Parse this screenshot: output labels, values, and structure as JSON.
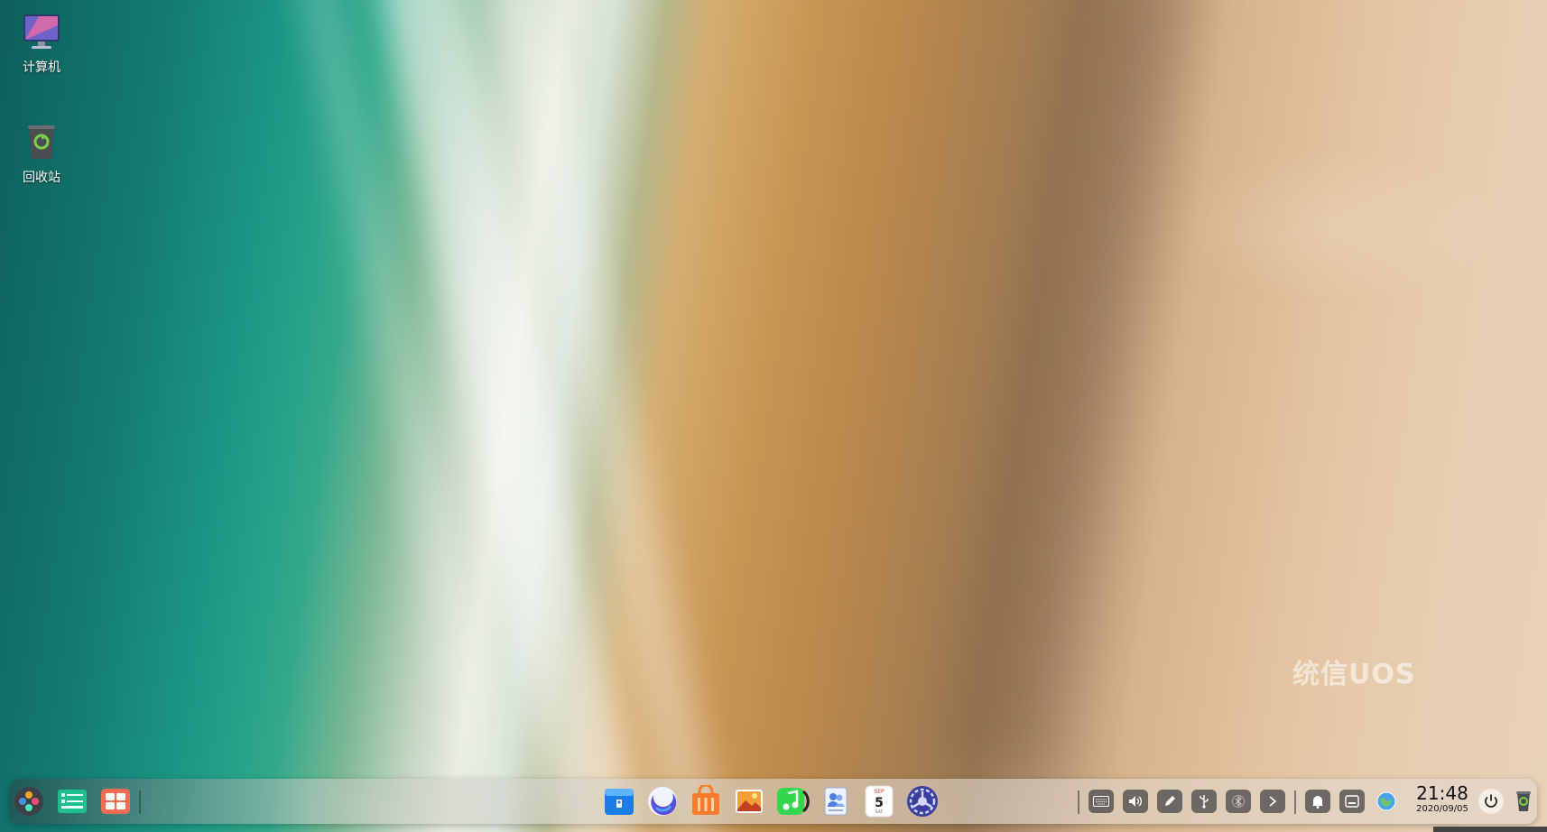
{
  "desktop": {
    "icons": [
      {
        "label": "计算机",
        "icon": "computer-icon"
      },
      {
        "label": "回收站",
        "icon": "trash-icon"
      }
    ],
    "watermark": "统信UOS"
  },
  "dock": {
    "left_items": [
      {
        "name": "launcher",
        "icon": "launcher-icon"
      },
      {
        "name": "multitask-view",
        "icon": "multitask-icon"
      },
      {
        "name": "show-desktop",
        "icon": "desktop-grid-icon"
      }
    ],
    "apps": [
      {
        "name": "file-manager",
        "icon": "folder-icon"
      },
      {
        "name": "browser",
        "icon": "browser-icon"
      },
      {
        "name": "app-store",
        "icon": "store-icon"
      },
      {
        "name": "image-viewer",
        "icon": "photo-icon"
      },
      {
        "name": "music",
        "icon": "music-icon"
      },
      {
        "name": "contacts",
        "icon": "contacts-icon"
      },
      {
        "name": "calendar",
        "icon": "calendar-icon",
        "month": "SEP",
        "day": "5",
        "weekday": "SAT"
      },
      {
        "name": "control-center",
        "icon": "settings-icon"
      }
    ],
    "tray": [
      {
        "name": "keyboard",
        "icon": "keyboard-icon"
      },
      {
        "name": "volume",
        "icon": "volume-icon"
      },
      {
        "name": "screenshot-pen",
        "icon": "pen-icon"
      },
      {
        "name": "usb",
        "icon": "usb-icon"
      },
      {
        "name": "bluetooth",
        "icon": "bluetooth-icon"
      },
      {
        "name": "expand-tray",
        "icon": "chevron-right-icon"
      },
      {
        "name": "notifications",
        "icon": "bell-icon"
      },
      {
        "name": "input-method",
        "icon": "ime-icon"
      },
      {
        "name": "network",
        "icon": "globe-icon"
      }
    ],
    "clock": {
      "time": "21:48",
      "date": "2020/09/05"
    },
    "power": {
      "icon": "power-icon"
    },
    "trash": {
      "icon": "trash-icon"
    }
  }
}
